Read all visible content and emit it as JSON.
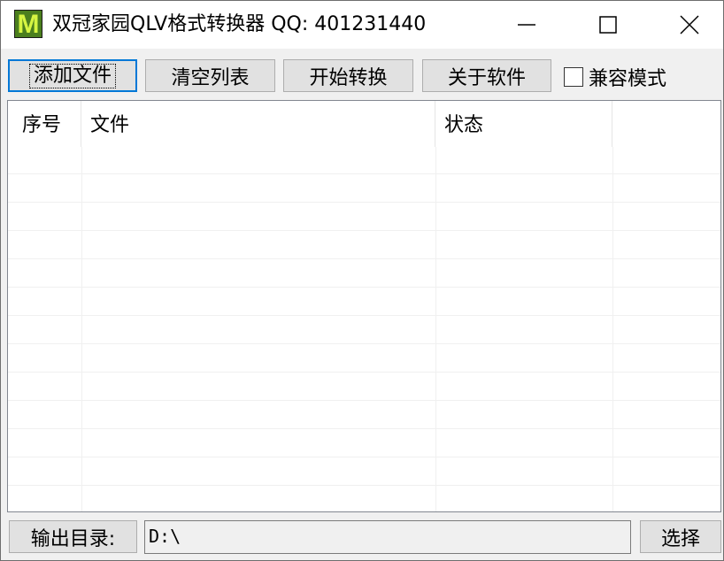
{
  "window": {
    "icon_letter": "M",
    "title": "双冠家园QLV格式转换器 QQ: 401231440"
  },
  "toolbar": {
    "add_files": "添加文件",
    "clear_list": "清空列表",
    "start_convert": "开始转换",
    "about": "关于软件",
    "compat_mode_label": "兼容模式",
    "compat_mode_checked": false
  },
  "list": {
    "columns": [
      "序号",
      "文件",
      "状态",
      ""
    ],
    "rows": []
  },
  "output": {
    "label": "输出目录:",
    "path": "D:\\",
    "select_button": "选择"
  },
  "colors": {
    "focus_border": "#0078d7",
    "icon_bg": "#4b7f1e",
    "icon_letter": "#d6f542"
  }
}
